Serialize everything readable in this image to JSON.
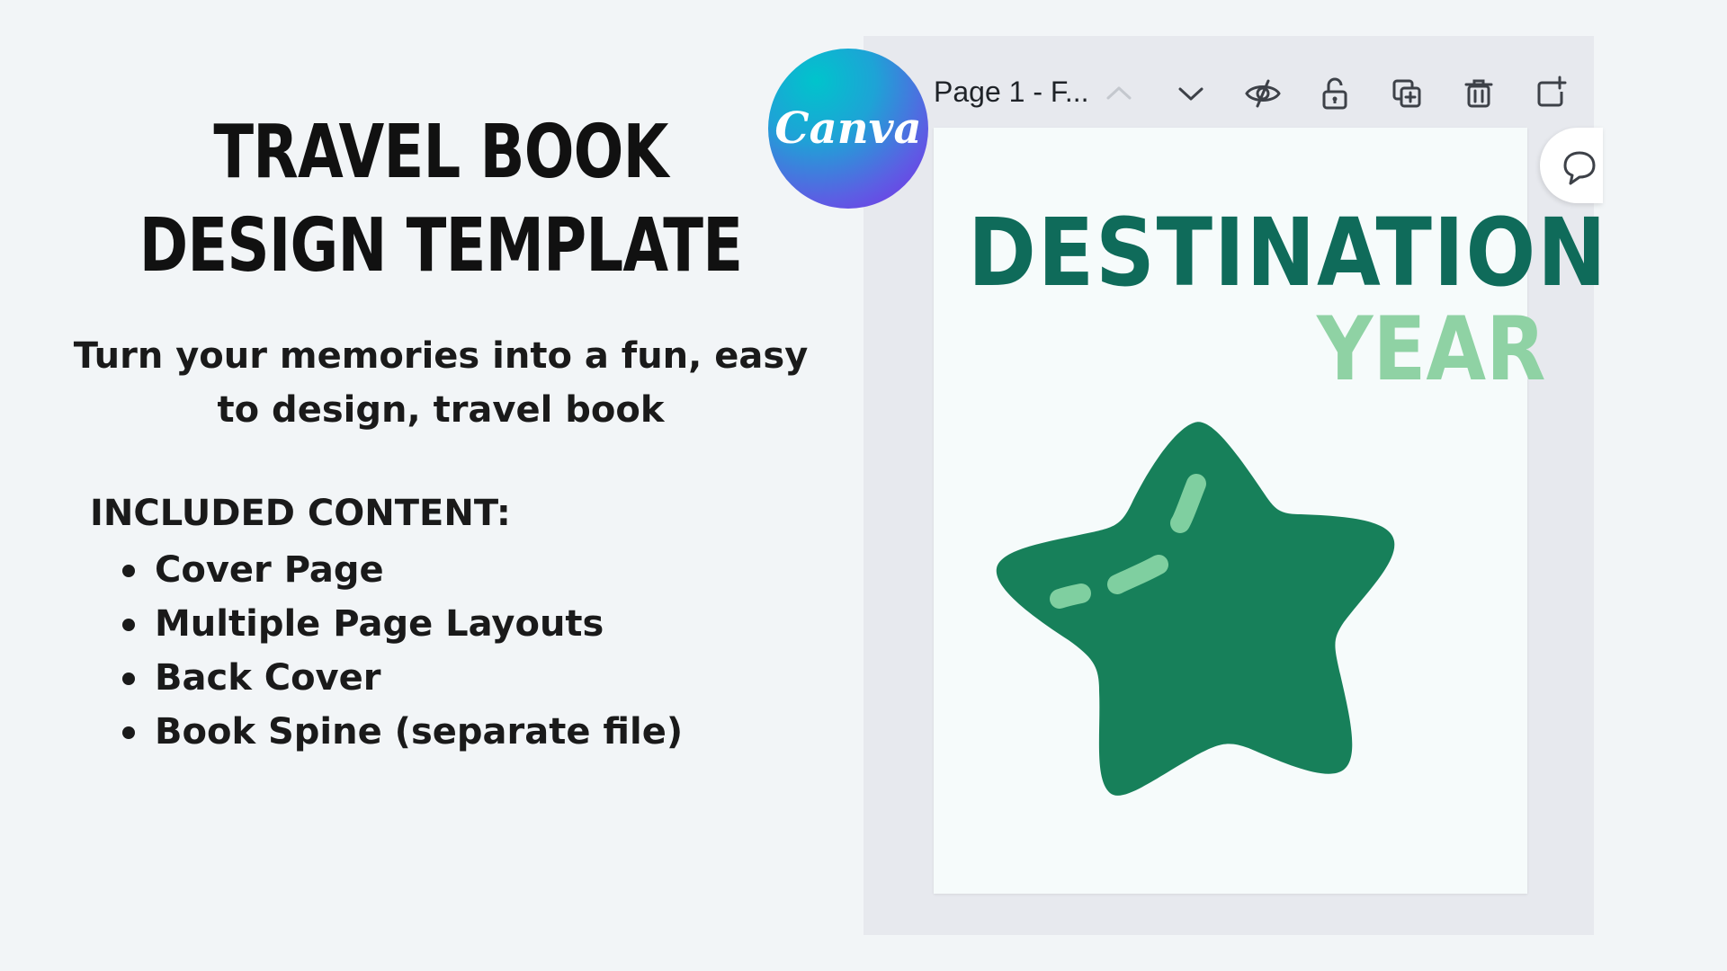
{
  "promo": {
    "title_line1": "TRAVEL BOOK",
    "title_line2": "DESIGN TEMPLATE",
    "subtitle": "Turn your memories into a fun, easy to design, travel book",
    "included_heading": "INCLUDED CONTENT:",
    "included_items": [
      "Cover Page",
      "Multiple Page Layouts",
      "Back Cover",
      "Book Spine (separate file)"
    ]
  },
  "logo": {
    "text": "Canva"
  },
  "editor": {
    "page_label": "Page 1 - F...",
    "toolbar_icons": [
      "chevron-up-icon",
      "chevron-down-icon",
      "hide-eye-icon",
      "lock-icon",
      "duplicate-page-icon",
      "trash-icon",
      "add-page-icon"
    ],
    "comment_icon": "comment-icon"
  },
  "canvas": {
    "heading": "DESTINATION",
    "subheading": "YEAR",
    "colors": {
      "heading": "#0f6b5a",
      "subheading": "#8fd2a4",
      "star": "#17805a",
      "star_highlight": "#7fcfa0"
    }
  }
}
